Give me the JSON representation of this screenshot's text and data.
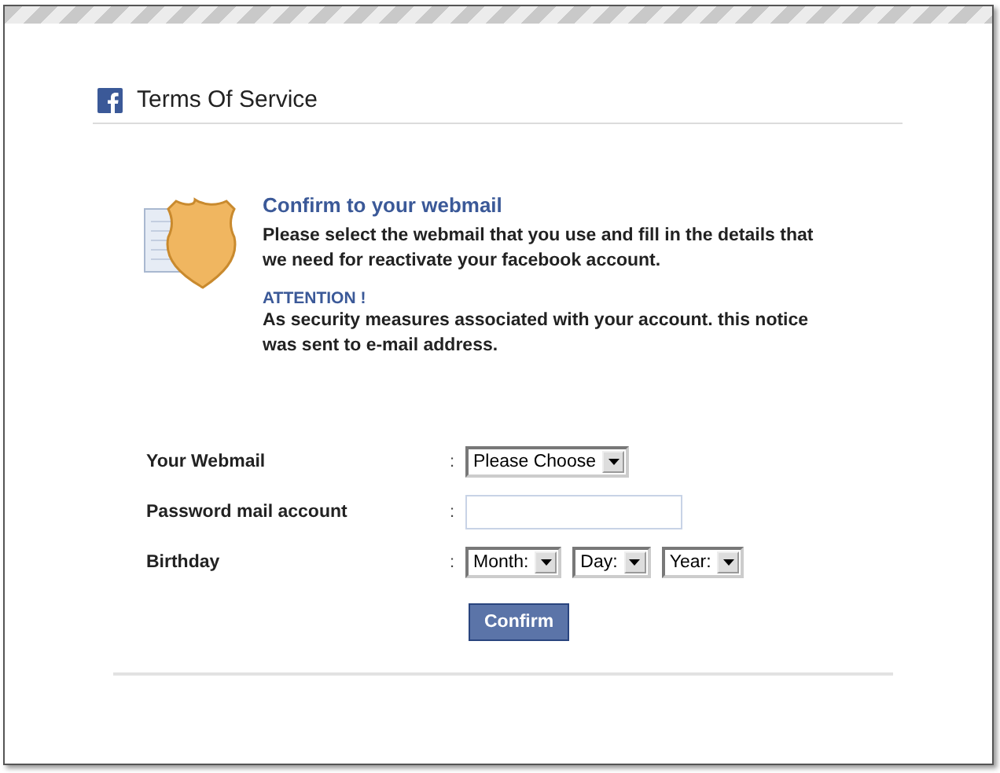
{
  "header": {
    "title": "Terms Of Service"
  },
  "notice": {
    "title": "Confirm to your webmail",
    "text": "Please select the webmail that you use and fill in the details that we need for reactivate your facebook account.",
    "attention_title": "ATTENTION !",
    "attention_text": "As security measures associated with your account. this notice was sent to e-mail address."
  },
  "form": {
    "fields": [
      {
        "label": "Your Webmail",
        "separator": ":",
        "kind": "select",
        "controls": [
          {
            "value": "Please Choose"
          }
        ]
      },
      {
        "label": "Password mail account",
        "separator": ":",
        "kind": "input"
      },
      {
        "label": "Birthday",
        "separator": ":",
        "kind": "select",
        "controls": [
          {
            "value": "Month:"
          },
          {
            "value": "Day:"
          },
          {
            "value": "Year:"
          }
        ]
      }
    ],
    "button": "Confirm"
  }
}
